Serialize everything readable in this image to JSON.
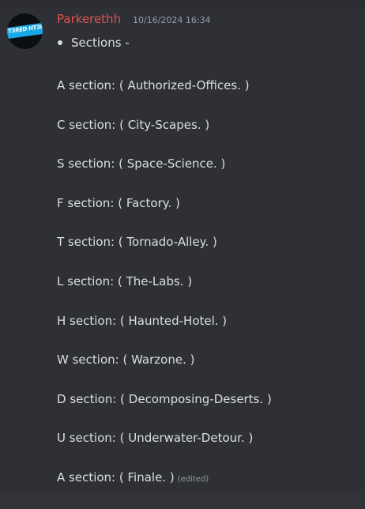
{
  "message": {
    "author": "Parkerethh",
    "timestamp": "10/16/2024 16:34",
    "avatar_text": "T3RED HT3IN",
    "bullet": "Sections -",
    "lines": [
      "A section: ( Authorized-Offices. )",
      "C section: ( City-Scapes. )",
      "S section: ( Space-Science. )",
      "F section: ( Factory. )",
      "T section: ( Tornado-Alley. )",
      "L section: ( The-Labs. )",
      "H section: ( Haunted-Hotel. )",
      "W section: ( Warzone. )",
      "D section: ( Decomposing-Deserts. )",
      "U section: ( Underwater-Detour. )",
      "A section: ( Finale. )"
    ],
    "edited_label": "(edited)"
  },
  "colors": {
    "background": "#2e3035",
    "author": "#e0524c",
    "text": "#dbdee1",
    "muted": "#949ba4",
    "avatar_accent": "#1ba7e6"
  }
}
